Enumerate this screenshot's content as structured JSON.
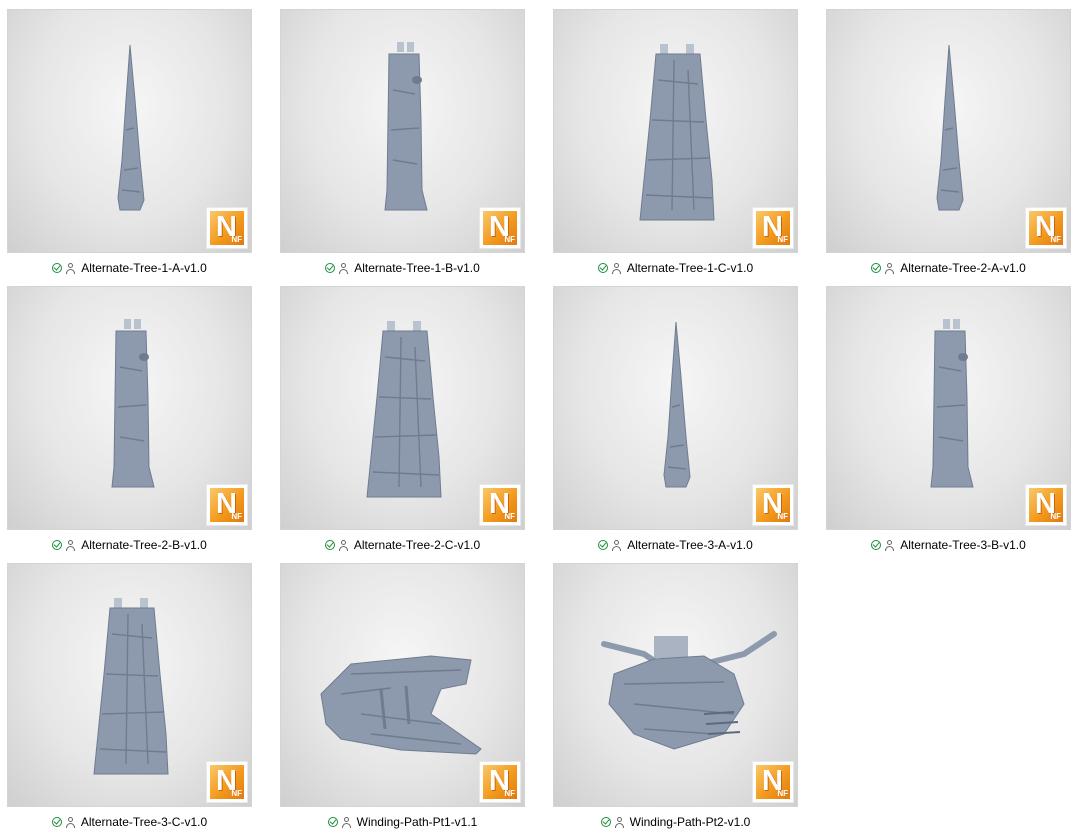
{
  "files": [
    {
      "name": "Alternate-Tree-1-A-v1.0",
      "shape": "spike"
    },
    {
      "name": "Alternate-Tree-1-B-v1.0",
      "shape": "slim"
    },
    {
      "name": "Alternate-Tree-1-C-v1.0",
      "shape": "wide"
    },
    {
      "name": "Alternate-Tree-2-A-v1.0",
      "shape": "spike"
    },
    {
      "name": "Alternate-Tree-2-B-v1.0",
      "shape": "slim"
    },
    {
      "name": "Alternate-Tree-2-C-v1.0",
      "shape": "wide"
    },
    {
      "name": "Alternate-Tree-3-A-v1.0",
      "shape": "spike"
    },
    {
      "name": "Alternate-Tree-3-B-v1.0",
      "shape": "slim"
    },
    {
      "name": "Alternate-Tree-3-C-v1.0",
      "shape": "wide"
    },
    {
      "name": "Winding-Path-Pt1-v1.1",
      "shape": "path1"
    },
    {
      "name": "Winding-Path-Pt2-v1.0",
      "shape": "path2"
    }
  ],
  "badge": {
    "letter": "N",
    "subtext": "NF"
  },
  "icons": {
    "status": "sync-ok-icon",
    "owner": "person-icon"
  },
  "colors": {
    "badge": "#f39a1e",
    "model": "#8d9aae",
    "status_ok": "#1e8e3e"
  }
}
